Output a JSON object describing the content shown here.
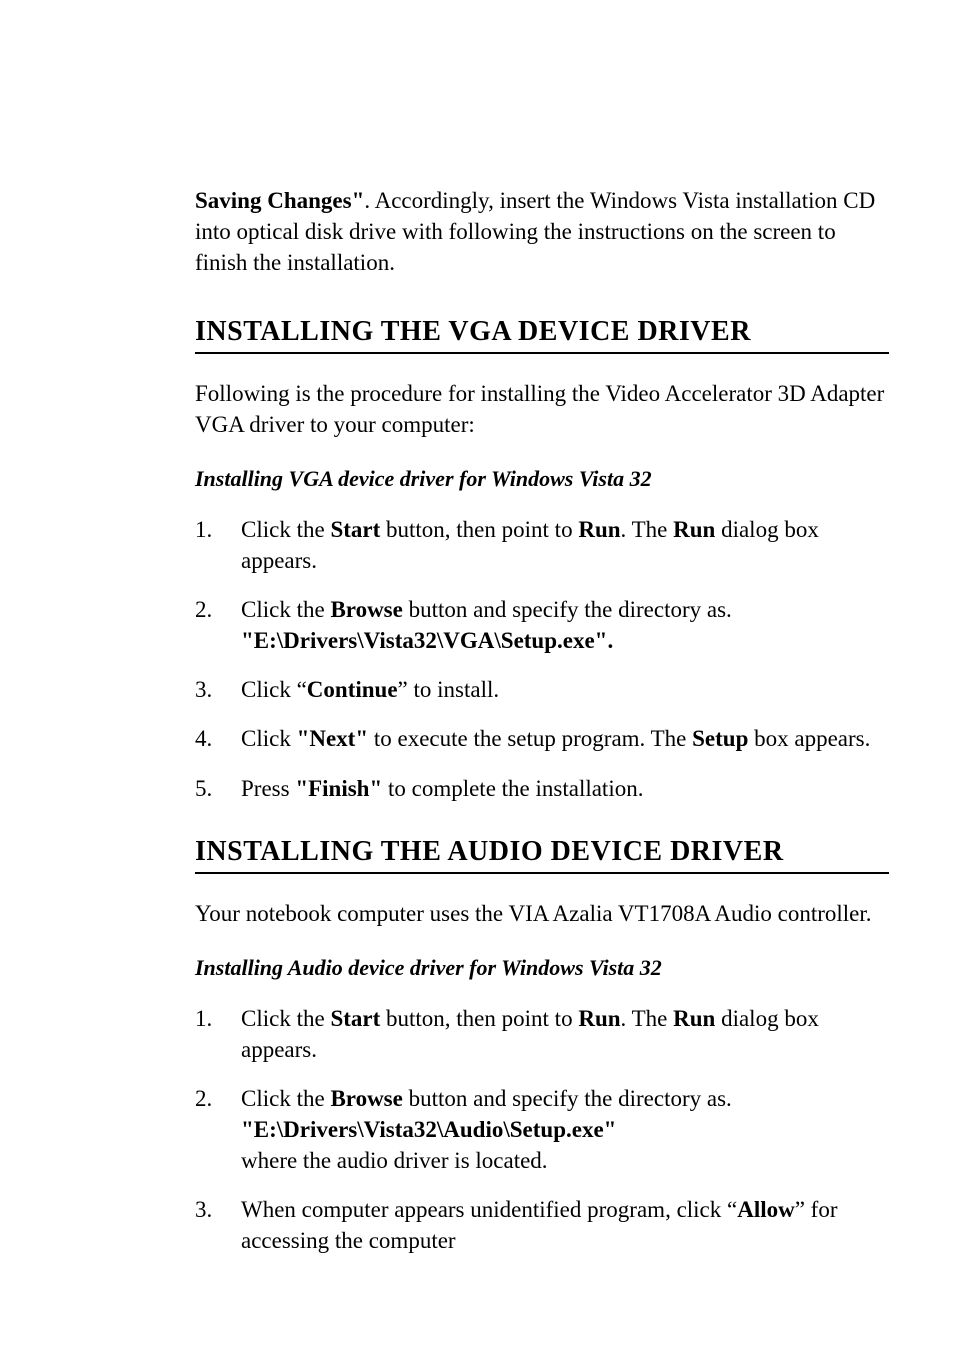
{
  "intro": {
    "bold_lead": "Saving Changes\"",
    "rest": ". Accordingly, insert the Windows Vista installation CD into optical disk drive with following the instructions on the screen to finish the installation."
  },
  "vga_section": {
    "heading": "INSTALLING THE VGA DEVICE DRIVER",
    "para": "Following is the procedure for installing the Video Accelerator 3D Adapter VGA driver to your computer:",
    "subheading": "Installing VGA device driver for Windows Vista 32",
    "items": [
      {
        "num": "1.",
        "parts": [
          {
            "t": "Click the ",
            "b": false
          },
          {
            "t": "Start",
            "b": true
          },
          {
            "t": " button, then point to ",
            "b": false
          },
          {
            "t": "Run",
            "b": true
          },
          {
            "t": ". The ",
            "b": false
          },
          {
            "t": "Run",
            "b": true
          },
          {
            "t": " dialog box appears.",
            "b": false
          }
        ]
      },
      {
        "num": "2.",
        "parts": [
          {
            "t": " Click the ",
            "b": false
          },
          {
            "t": "Browse",
            "b": true
          },
          {
            "t": " button and specify the directory as.",
            "b": false
          }
        ],
        "line2_parts": [
          {
            "t": "\"E:\\Drivers\\Vista32\\VGA\\Setup.exe\".",
            "b": true
          }
        ]
      },
      {
        "num": "3.",
        "parts": [
          {
            "t": " Click “",
            "b": false
          },
          {
            "t": "Continue",
            "b": true
          },
          {
            "t": "” to install.",
            "b": false
          }
        ]
      },
      {
        "num": "4.",
        "parts": [
          {
            "t": " Click ",
            "b": false
          },
          {
            "t": "\"Next\"",
            "b": true
          },
          {
            "t": " to execute the setup program. The ",
            "b": false
          },
          {
            "t": "Setup",
            "b": true
          },
          {
            "t": " box appears.",
            "b": false
          }
        ]
      },
      {
        "num": "5.",
        "parts": [
          {
            "t": " Press ",
            "b": false
          },
          {
            "t": "\"Finish\"",
            "b": true
          },
          {
            "t": " to complete the installation.",
            "b": false
          }
        ]
      }
    ]
  },
  "audio_section": {
    "heading": "INSTALLING THE AUDIO DEVICE DRIVER",
    "para": "Your notebook computer uses the VIA Azalia VT1708A Audio controller.",
    "subheading": "Installing Audio device driver for Windows Vista 32",
    "items": [
      {
        "num": "1.",
        "parts": [
          {
            "t": "Click the ",
            "b": false
          },
          {
            "t": "Start",
            "b": true
          },
          {
            "t": " button, then point to ",
            "b": false
          },
          {
            "t": "Run",
            "b": true
          },
          {
            "t": ". The ",
            "b": false
          },
          {
            "t": "Run",
            "b": true
          },
          {
            "t": " dialog box appears.",
            "b": false
          }
        ]
      },
      {
        "num": "2.",
        "parts": [
          {
            "t": " Click the ",
            "b": false
          },
          {
            "t": "Browse",
            "b": true
          },
          {
            "t": " button and specify the directory as.",
            "b": false
          }
        ],
        "line2_parts": [
          {
            "t": "\"E:\\Drivers\\Vista32\\Audio\\Setup.exe\"",
            "b": true
          }
        ],
        "line3_parts": [
          {
            "t": "where the audio driver is located.",
            "b": false
          }
        ]
      },
      {
        "num": "3.",
        "parts": [
          {
            "t": " When computer appears unidentified program, click “",
            "b": false
          },
          {
            "t": "Allow",
            "b": true
          },
          {
            "t": "” for accessing the computer",
            "b": false
          }
        ]
      }
    ]
  }
}
